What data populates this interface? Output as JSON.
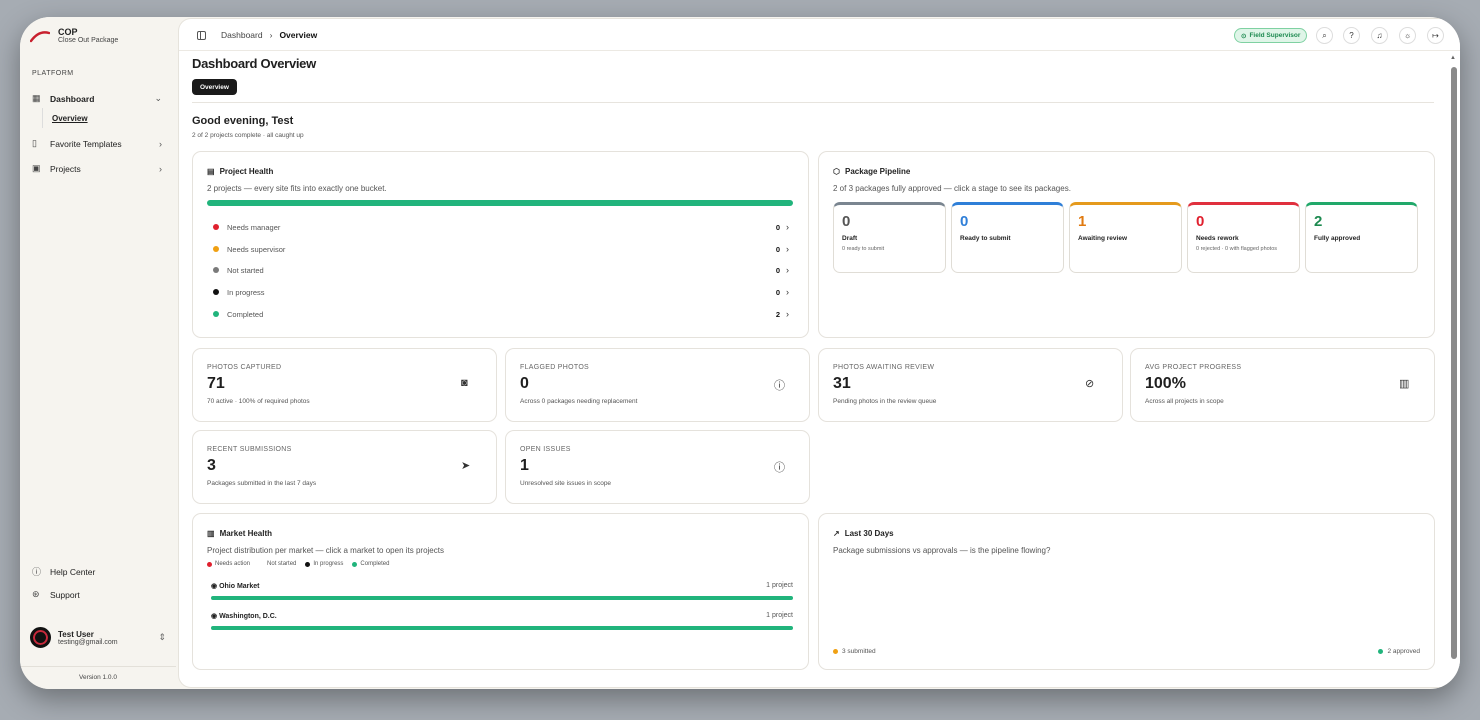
{
  "sidebar": {
    "brand_name": "COP",
    "brand_sub": "Close Out Package",
    "section_label": "PLATFORM",
    "items": [
      {
        "label": "Dashboard",
        "icon": "dashboard-icon"
      },
      {
        "label": "Overview"
      },
      {
        "label": "Favorite Templates",
        "icon": "bookmark-icon"
      },
      {
        "label": "Projects",
        "icon": "building-icon"
      }
    ],
    "help": "Help Center",
    "support": "Support",
    "user_name": "Test User",
    "user_email": "testing@gmail.com",
    "version": "Version 1.0.0"
  },
  "topbar": {
    "breadcrumb_root": "Dashboard",
    "breadcrumb_current": "Overview",
    "role_badge": "Field Supervisor"
  },
  "page": {
    "title": "Dashboard Overview",
    "tab": "Overview",
    "greeting": "Good evening, Test",
    "greeting_sub": "2 of 2 projects complete · all caught up"
  },
  "project_health": {
    "title": "Project Health",
    "desc": "2 projects — every site fits into exactly one bucket.",
    "rows": [
      {
        "label": "Needs manager",
        "value": "0",
        "color": "#e0202e"
      },
      {
        "label": "Needs supervisor",
        "value": "0",
        "color": "#f0a012"
      },
      {
        "label": "Not started",
        "value": "0",
        "color": "#7a7a7a"
      },
      {
        "label": "In progress",
        "value": "0",
        "color": "#111111"
      },
      {
        "label": "Completed",
        "value": "2",
        "color": "#21b47c"
      }
    ]
  },
  "pipeline": {
    "title": "Package Pipeline",
    "desc": "2 of 3 packages fully approved — click a stage to see its packages.",
    "stages": [
      {
        "num": "0",
        "label": "Draft",
        "sub": "0 ready to submit",
        "color": "#7a8590",
        "num_color": "#555555"
      },
      {
        "num": "0",
        "label": "Ready to submit",
        "sub": "",
        "color": "#2f7fd8",
        "num_color": "#2f7fd8"
      },
      {
        "num": "1",
        "label": "Awaiting review",
        "sub": "",
        "color": "#e59a1c",
        "num_color": "#e07a10"
      },
      {
        "num": "0",
        "label": "Needs rework",
        "sub": "0 rejected · 0 with flagged photos",
        "color": "#e0303e",
        "num_color": "#e0202e"
      },
      {
        "num": "2",
        "label": "Fully approved",
        "sub": "",
        "color": "#21a86a",
        "num_color": "#1d8a50"
      }
    ]
  },
  "metrics": [
    {
      "label": "PHOTOS CAPTURED",
      "value": "71",
      "sub": "70 active · 100% of required photos",
      "icon": "camera-icon"
    },
    {
      "label": "FLAGGED PHOTOS",
      "value": "0",
      "sub": "Across 0 packages needing replacement",
      "icon": "alert-circle-icon"
    },
    {
      "label": "PHOTOS AWAITING REVIEW",
      "value": "31",
      "sub": "Pending photos in the review queue",
      "icon": "check-circle-icon"
    },
    {
      "label": "AVG PROJECT PROGRESS",
      "value": "100%",
      "sub": "Across all projects in scope",
      "icon": "bar-chart-icon"
    },
    {
      "label": "RECENT SUBMISSIONS",
      "value": "3",
      "sub": "Packages submitted in the last 7 days",
      "icon": "send-icon"
    },
    {
      "label": "OPEN ISSUES",
      "value": "1",
      "sub": "Unresolved site issues in scope",
      "icon": "alert-circle-icon"
    }
  ],
  "market_health": {
    "title": "Market Health",
    "desc": "Project distribution per market — click a market to open its projects",
    "legend": [
      "Needs action",
      "Not started",
      "In progress",
      "Completed"
    ],
    "markets": [
      {
        "name": "Ohio Market",
        "count": "1 project",
        "completed_fraction": 1.0
      },
      {
        "name": "Washington, D.C.",
        "count": "1 project",
        "completed_fraction": 1.0
      }
    ]
  },
  "last30": {
    "title": "Last 30 Days",
    "desc": "Package submissions vs approvals — is the pipeline flowing?",
    "submitted": "3 submitted",
    "approved": "2 approved"
  }
}
